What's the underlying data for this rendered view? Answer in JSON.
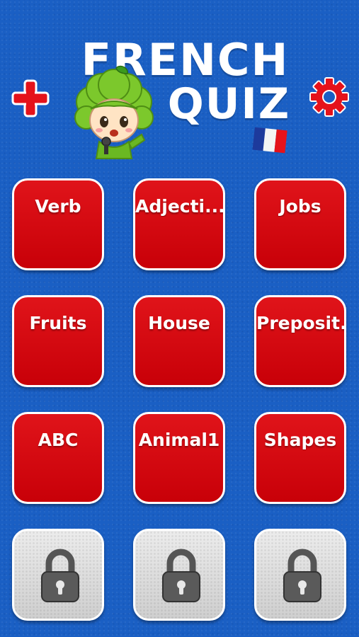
{
  "header": {
    "title_line1": "FRENCH",
    "title_line2": "QUIZ",
    "add_icon": "plus-icon",
    "settings_icon": "gear-icon",
    "mascot": "broccoli-character-icon",
    "flag": "france-flag-icon"
  },
  "categories": [
    {
      "label": "Verb"
    },
    {
      "label": "Adjecti..."
    },
    {
      "label": "Jobs"
    },
    {
      "label": "Fruits"
    },
    {
      "label": "House"
    },
    {
      "label": "Preposit..."
    },
    {
      "label": "ABC"
    },
    {
      "label": "Animal1"
    },
    {
      "label": "Shapes"
    }
  ],
  "locked_tiles": [
    {
      "icon": "lock-icon"
    },
    {
      "icon": "lock-icon"
    },
    {
      "icon": "lock-icon"
    }
  ],
  "colors": {
    "background": "#1a5fc4",
    "tile_red": "#d40a10",
    "tile_locked": "#d9d9d9",
    "accent_red": "#e0121a"
  }
}
